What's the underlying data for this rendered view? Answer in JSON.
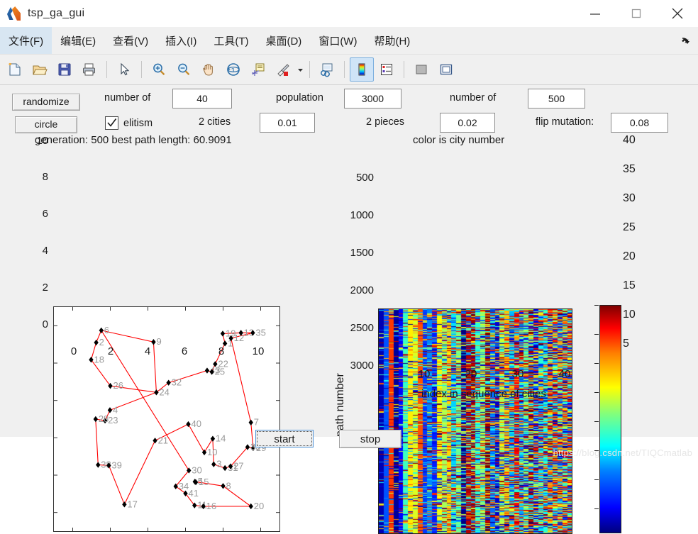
{
  "window": {
    "title": "tsp_ga_gui",
    "icon": "matlab-icon",
    "controls": {
      "minimize": "minimize-icon",
      "maximize": "maximize-icon",
      "close": "close-icon"
    }
  },
  "menubar": {
    "items": [
      {
        "label": "文件(F)",
        "active": true
      },
      {
        "label": "编辑(E)",
        "active": false
      },
      {
        "label": "查看(V)",
        "active": false
      },
      {
        "label": "插入(I)",
        "active": false
      },
      {
        "label": "工具(T)",
        "active": false
      },
      {
        "label": "桌面(D)",
        "active": false
      },
      {
        "label": "窗口(W)",
        "active": false
      },
      {
        "label": "帮助(H)",
        "active": false
      }
    ],
    "overflow_icon": "arrow-down-right-icon"
  },
  "toolbar": {
    "buttons": [
      "new-figure-icon",
      "open-folder-icon",
      "save-icon",
      "print-icon",
      "pointer-icon",
      "zoom-in-icon",
      "zoom-out-icon",
      "pan-hand-icon",
      "rotate-3d-icon",
      "data-cursor-icon",
      "brush-icon",
      "brush-dropdown-caret",
      "link-plot-icon",
      "colorbar-icon",
      "legend-icon",
      "hide-plot-tools-icon",
      "show-plot-tools-icon"
    ]
  },
  "controls": {
    "randomize_label": "randomize",
    "circle_label": "circle",
    "number_of_cities_label": "number of",
    "number_of_cities_value": "40",
    "population_label": "population",
    "population_value": "3000",
    "number_of_generations_label": "number of",
    "number_of_generations_value": "500",
    "elitism_label": "elitism",
    "elitism_checked": true,
    "swap_two_cities_label": "2 cities",
    "swap_two_cities_value": "0.01",
    "swap_two_pieces_label": "2 pieces",
    "swap_two_pieces_value": "0.02",
    "flip_mutation_label": "flip mutation:",
    "flip_mutation_value": "0.08"
  },
  "status": {
    "left": "generation: 500  best path length: 60.9091",
    "right": "color is city number"
  },
  "actions": {
    "start_label": "start",
    "stop_label": "stop"
  },
  "watermark": "https://blog.csdn.net/TIQCmatlab",
  "chart_data": [
    {
      "type": "scatter",
      "name": "best-tsp-route-plot",
      "title": "generation: 500  best path length: 60.9091",
      "xlabel": "",
      "ylabel": "",
      "xlim": [
        -1,
        11
      ],
      "ylim": [
        -1,
        11
      ],
      "xticks": [
        0,
        2,
        4,
        6,
        8,
        10
      ],
      "yticks": [
        0,
        2,
        4,
        6,
        8,
        10
      ],
      "grid": false,
      "marker_color": "#000000",
      "path_color": "#ff0000",
      "label_color": "#9a9a9a",
      "points": [
        {
          "label": "6",
          "x": 1.52,
          "y": 9.75
        },
        {
          "label": "2",
          "x": 1.25,
          "y": 9.1
        },
        {
          "label": "18",
          "x": 0.98,
          "y": 8.18
        },
        {
          "label": "9",
          "x": 4.3,
          "y": 9.13
        },
        {
          "label": "26",
          "x": 2.0,
          "y": 6.78
        },
        {
          "label": "24",
          "x": 4.45,
          "y": 6.43
        },
        {
          "label": "32",
          "x": 5.1,
          "y": 6.95
        },
        {
          "label": "43",
          "x": 7.15,
          "y": 7.6
        },
        {
          "label": "25",
          "x": 7.4,
          "y": 7.53
        },
        {
          "label": "22",
          "x": 7.58,
          "y": 7.95
        },
        {
          "label": "1",
          "x": 8.1,
          "y": 9.05
        },
        {
          "label": "12",
          "x": 8.42,
          "y": 9.33
        },
        {
          "label": "19",
          "x": 7.98,
          "y": 9.58
        },
        {
          "label": "13",
          "x": 8.95,
          "y": 9.62
        },
        {
          "label": "35",
          "x": 9.58,
          "y": 9.62
        },
        {
          "label": "7",
          "x": 9.48,
          "y": 4.82
        },
        {
          "label": "29",
          "x": 9.6,
          "y": 3.45
        },
        {
          "label": "33",
          "x": 9.3,
          "y": 3.5
        },
        {
          "label": "4",
          "x": 1.98,
          "y": 5.48
        },
        {
          "label": "23",
          "x": 1.72,
          "y": 4.92
        },
        {
          "label": "28",
          "x": 1.22,
          "y": 5.0
        },
        {
          "label": "38",
          "x": 1.35,
          "y": 2.55
        },
        {
          "label": "39",
          "x": 1.92,
          "y": 2.52
        },
        {
          "label": "17",
          "x": 2.75,
          "y": 0.43
        },
        {
          "label": "21",
          "x": 4.38,
          "y": 3.85
        },
        {
          "label": "40",
          "x": 6.15,
          "y": 4.73
        },
        {
          "label": "14",
          "x": 7.45,
          "y": 3.95
        },
        {
          "label": "10",
          "x": 7.0,
          "y": 3.22
        },
        {
          "label": "3",
          "x": 7.5,
          "y": 2.58
        },
        {
          "label": "31",
          "x": 8.1,
          "y": 2.38
        },
        {
          "label": "27",
          "x": 8.4,
          "y": 2.47
        },
        {
          "label": "30",
          "x": 6.18,
          "y": 2.25
        },
        {
          "label": "34",
          "x": 5.48,
          "y": 1.4
        },
        {
          "label": "5",
          "x": 6.5,
          "y": 1.65
        },
        {
          "label": "15",
          "x": 6.55,
          "y": 1.62
        },
        {
          "label": "8",
          "x": 8.0,
          "y": 1.42
        },
        {
          "label": "41",
          "x": 6.0,
          "y": 1.02
        },
        {
          "label": "11",
          "x": 6.48,
          "y": 0.38
        },
        {
          "label": "16",
          "x": 6.95,
          "y": 0.33
        },
        {
          "label": "20",
          "x": 9.48,
          "y": 0.33
        }
      ],
      "route": [
        "6",
        "2",
        "18",
        "26",
        "24",
        "32",
        "43",
        "25",
        "22",
        "1",
        "19",
        "13",
        "35",
        "12",
        "7",
        "29",
        "33",
        "27",
        "31",
        "3",
        "14",
        "10",
        "40",
        "21",
        "17",
        "39",
        "38",
        "28",
        "23",
        "4",
        "24",
        "9",
        "6",
        "30",
        "34",
        "41",
        "11",
        "16",
        "20",
        "8",
        "5",
        "15"
      ]
    },
    {
      "type": "heatmap",
      "name": "path-population-heatmap",
      "title": "color is city number",
      "xlabel": "index in sequence of cities",
      "ylabel": "path number",
      "xlim": [
        1,
        40
      ],
      "ylim": [
        1,
        3000
      ],
      "xticks": [
        10,
        20,
        30,
        40
      ],
      "yticks": [
        500,
        1000,
        1500,
        2000,
        2500,
        3000
      ],
      "colormap": "jet",
      "colorbar": {
        "min": 1,
        "max": 40,
        "ticks": [
          5,
          10,
          15,
          20,
          25,
          30,
          35,
          40
        ],
        "label": ""
      },
      "columns": 40,
      "rows": 3000,
      "description": "Each row is one candidate path; column = index in the sequence; color = city number 1-40"
    }
  ]
}
